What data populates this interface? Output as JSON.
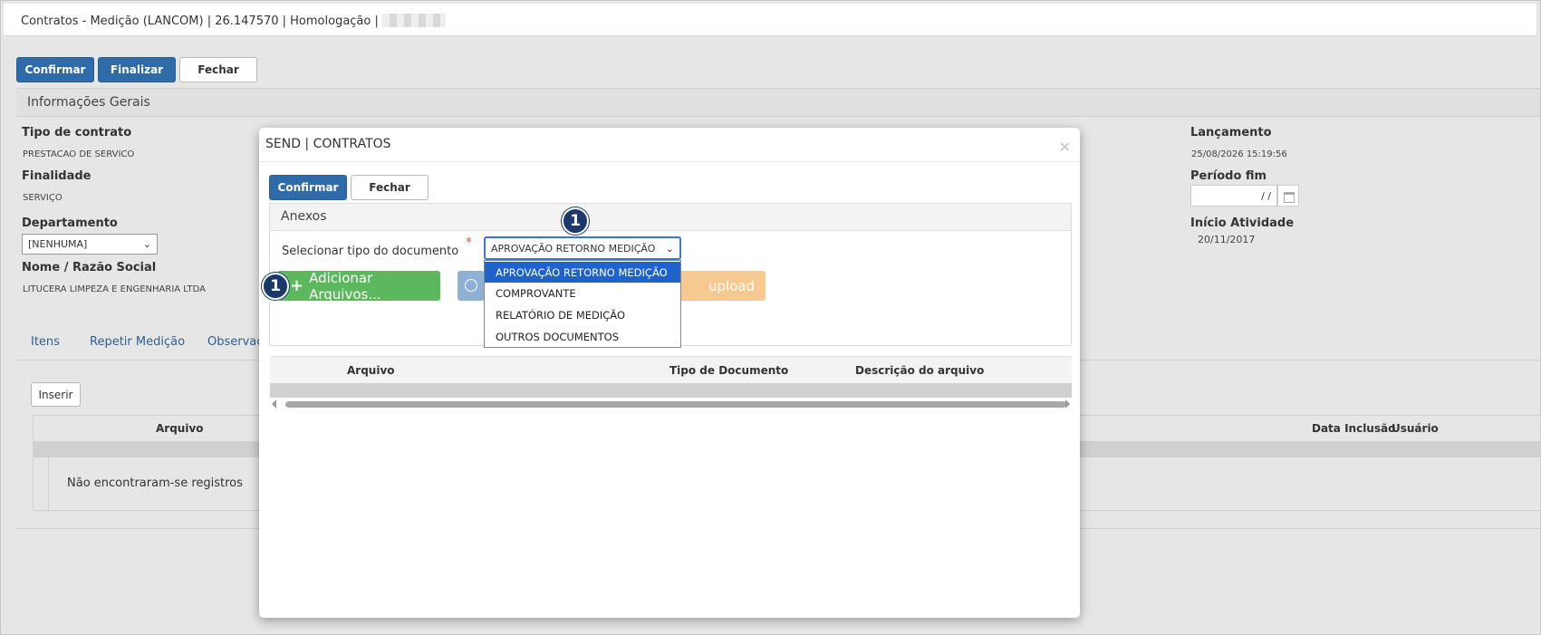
{
  "header": {
    "title": "Contratos - Medição (LANCOM) | 26.147570 | Homologação |"
  },
  "toolbar": {
    "confirm": "Confirmar",
    "finalize": "Finalizar",
    "close": "Fechar"
  },
  "panel": {
    "title": "Informações Gerais",
    "tipo_label": "Tipo de contrato",
    "tipo_value": "PRESTACAO DE SERVICO",
    "finalidade_label": "Finalidade",
    "finalidade_value": "SERVIÇO",
    "departamento_label": "Departamento",
    "departamento_value": "[NENHUMA]",
    "nome_label": "Nome / Razão Social",
    "nome_value": "LITUCERA LIMPEZA E ENGENHARIA LTDA",
    "lancamento_label": "Lançamento",
    "lancamento_value": "25/08/2026 15:19:56",
    "periodo_label": "Período fim",
    "periodo_value": "/ /",
    "inicio_label": "Início Atividade",
    "inicio_value": "20/11/2017"
  },
  "tabs": [
    "Itens",
    "Repetir Medição",
    "Observaç"
  ],
  "grid": {
    "insert": "Inserir",
    "col_arquivo": "Arquivo",
    "col_data": "Data Inclusão",
    "col_usuario": "Usuário",
    "empty": "Não encontraram-se registros"
  },
  "modal": {
    "title": "SEND | CONTRATOS",
    "close_icon": "×",
    "confirm": "Confirmar",
    "close": "Fechar",
    "section": "Anexos",
    "select_label": "Selecionar tipo do documento",
    "required": "*",
    "select_value": "APROVAÇÃO RETORNO MEDIÇÃO",
    "options": [
      "APROVAÇÃO RETORNO MEDIÇÃO",
      "COMPROVANTE",
      "RELATÓRIO DE MEDIÇÃO",
      "OUTROS DOCUMENTOS"
    ],
    "add_files": "Adicionar Arquivos...",
    "upload": "upload",
    "col_arquivo": "Arquivo",
    "col_tipo": "Tipo de Documento",
    "col_desc": "Descrição do arquivo"
  },
  "badges": {
    "a": "1",
    "b": "1"
  },
  "colors": {
    "primary": "#2f6aa9",
    "success": "#5cb85c",
    "warning": "#f5c98f",
    "badge": "#1b3a6b",
    "selected": "#1e63c9"
  }
}
